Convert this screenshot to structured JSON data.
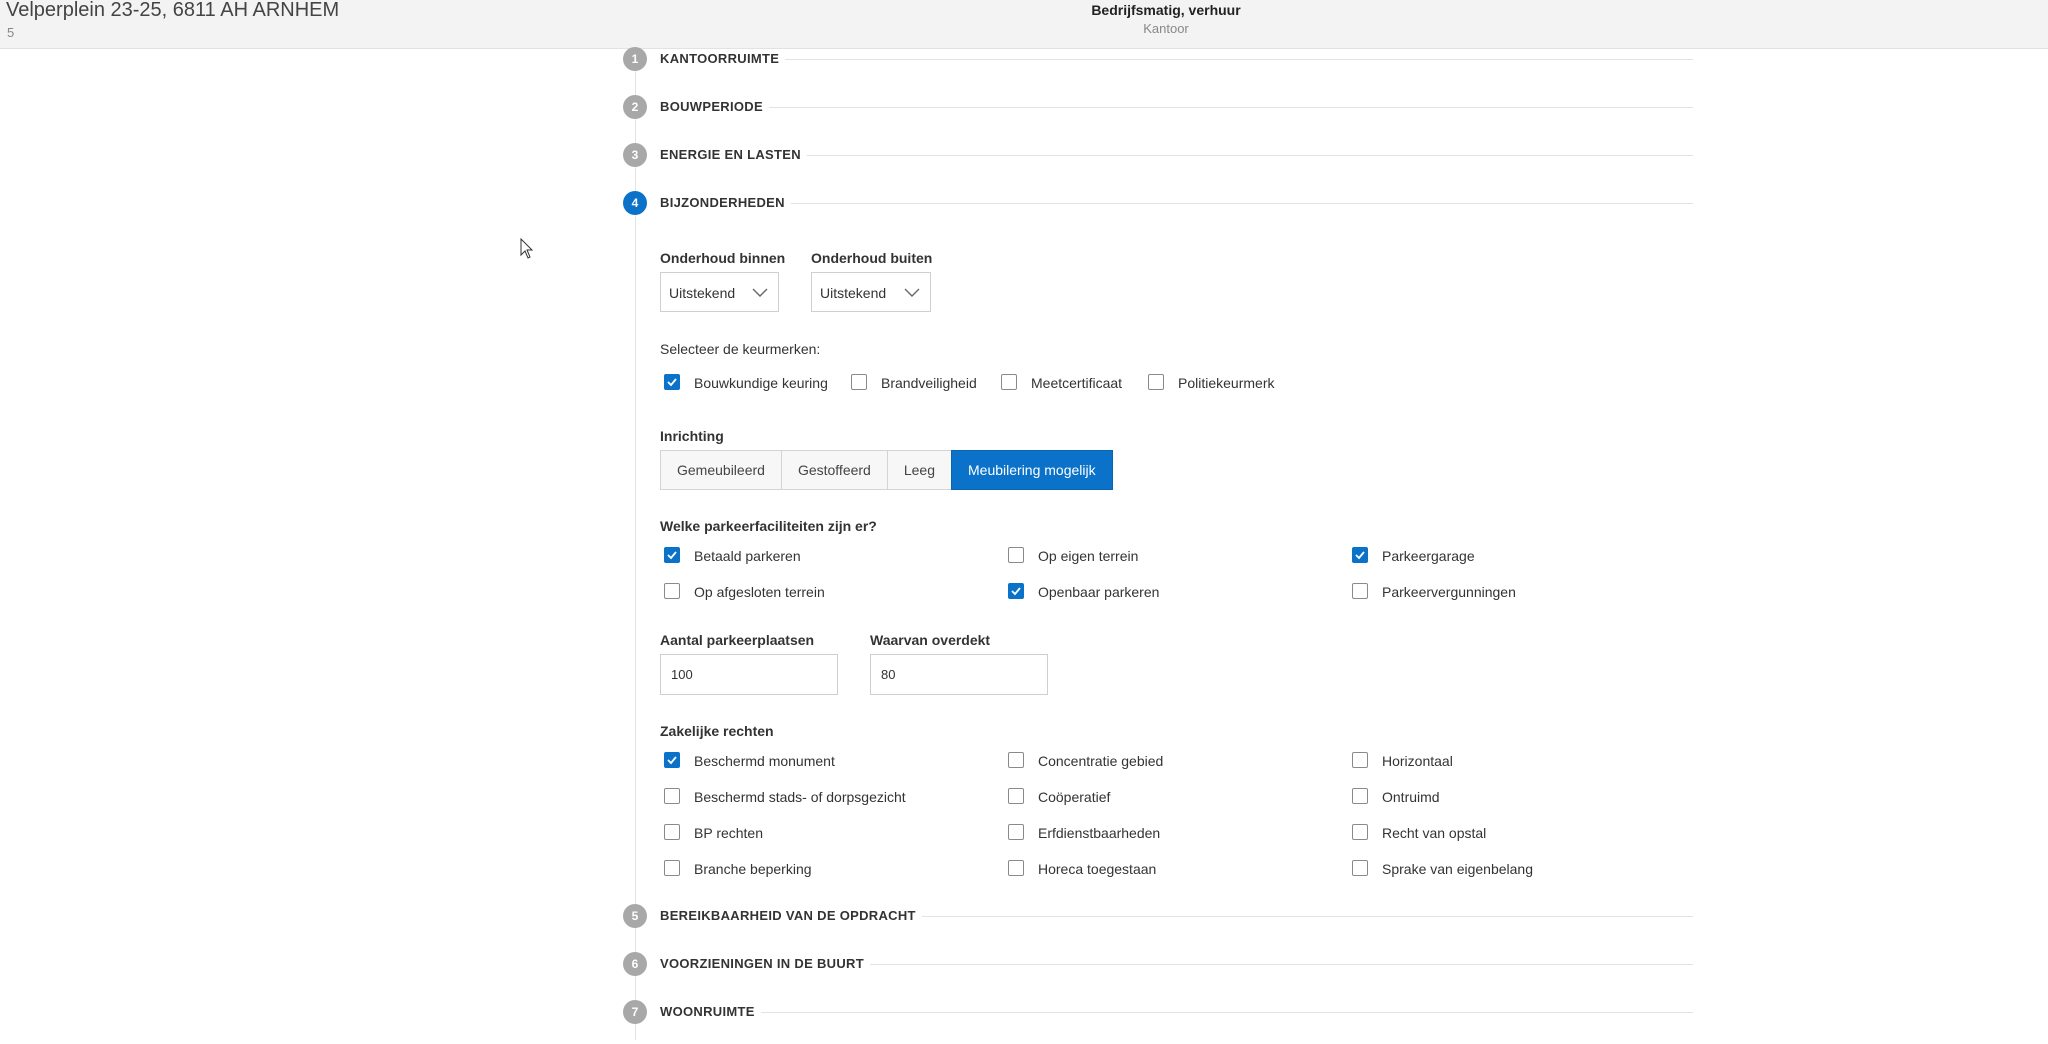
{
  "header": {
    "address": "Velperplein 23-25, 6811 AH ARNHEM",
    "address_sub": "5",
    "property_type": "Bedrijfsmatig, verhuur",
    "property_subtype": "Kantoor"
  },
  "steps": [
    {
      "number": "1",
      "title": "KANTOORRUIMTE"
    },
    {
      "number": "2",
      "title": "BOUWPERIODE"
    },
    {
      "number": "3",
      "title": "ENERGIE EN LASTEN"
    },
    {
      "number": "4",
      "title": "BIJZONDERHEDEN"
    },
    {
      "number": "5",
      "title": "BEREIKBAARHEID VAN DE OPDRACHT"
    },
    {
      "number": "6",
      "title": "VOORZIENINGEN IN DE BUURT"
    },
    {
      "number": "7",
      "title": "WOONRUIMTE"
    }
  ],
  "maintenance": {
    "inside_label": "Onderhoud binnen",
    "inside_value": "Uitstekend",
    "outside_label": "Onderhoud buiten",
    "outside_value": "Uitstekend"
  },
  "quality_marks": {
    "label": "Selecteer de keurmerken:",
    "items": [
      {
        "label": "Bouwkundige keuring",
        "checked": true
      },
      {
        "label": "Brandveiligheid",
        "checked": false
      },
      {
        "label": "Meetcertificaat",
        "checked": false
      },
      {
        "label": "Politiekeurmerk",
        "checked": false
      }
    ]
  },
  "furnishing": {
    "label": "Inrichting",
    "options": [
      "Gemeubileerd",
      "Gestoffeerd",
      "Leeg",
      "Meubilering mogelijk"
    ],
    "selected": "Meubilering mogelijk"
  },
  "parking": {
    "label": "Welke parkeerfaciliteiten zijn er?",
    "items": [
      {
        "label": "Betaald parkeren",
        "checked": true
      },
      {
        "label": "Op eigen terrein",
        "checked": false
      },
      {
        "label": "Parkeergarage",
        "checked": true
      },
      {
        "label": "Op afgesloten terrein",
        "checked": false
      },
      {
        "label": "Openbaar parkeren",
        "checked": true
      },
      {
        "label": "Parkeervergunningen",
        "checked": false
      }
    ],
    "spaces_label": "Aantal parkeerplaatsen",
    "spaces_value": "100",
    "covered_label": "Waarvan overdekt",
    "covered_value": "80"
  },
  "rights": {
    "label": "Zakelijke rechten",
    "items": [
      {
        "label": "Beschermd monument",
        "checked": true
      },
      {
        "label": "Concentratie gebied",
        "checked": false
      },
      {
        "label": "Horizontaal",
        "checked": false
      },
      {
        "label": "Beschermd stads- of dorpsgezicht",
        "checked": false
      },
      {
        "label": "Coöperatief",
        "checked": false
      },
      {
        "label": "Ontruimd",
        "checked": false
      },
      {
        "label": "BP rechten",
        "checked": false
      },
      {
        "label": "Erfdienstbaarheden",
        "checked": false
      },
      {
        "label": "Recht van opstal",
        "checked": false
      },
      {
        "label": "Branche beperking",
        "checked": false
      },
      {
        "label": "Horeca toegestaan",
        "checked": false
      },
      {
        "label": "Sprake van eigenbelang",
        "checked": false
      }
    ]
  },
  "colors": {
    "accent": "#0a72c9",
    "step_inactive": "#a8a8a8"
  },
  "icons": {
    "cursor": "mouse-pointer-icon",
    "dropdown": "chevron-down-icon",
    "check": "checkmark-icon"
  }
}
